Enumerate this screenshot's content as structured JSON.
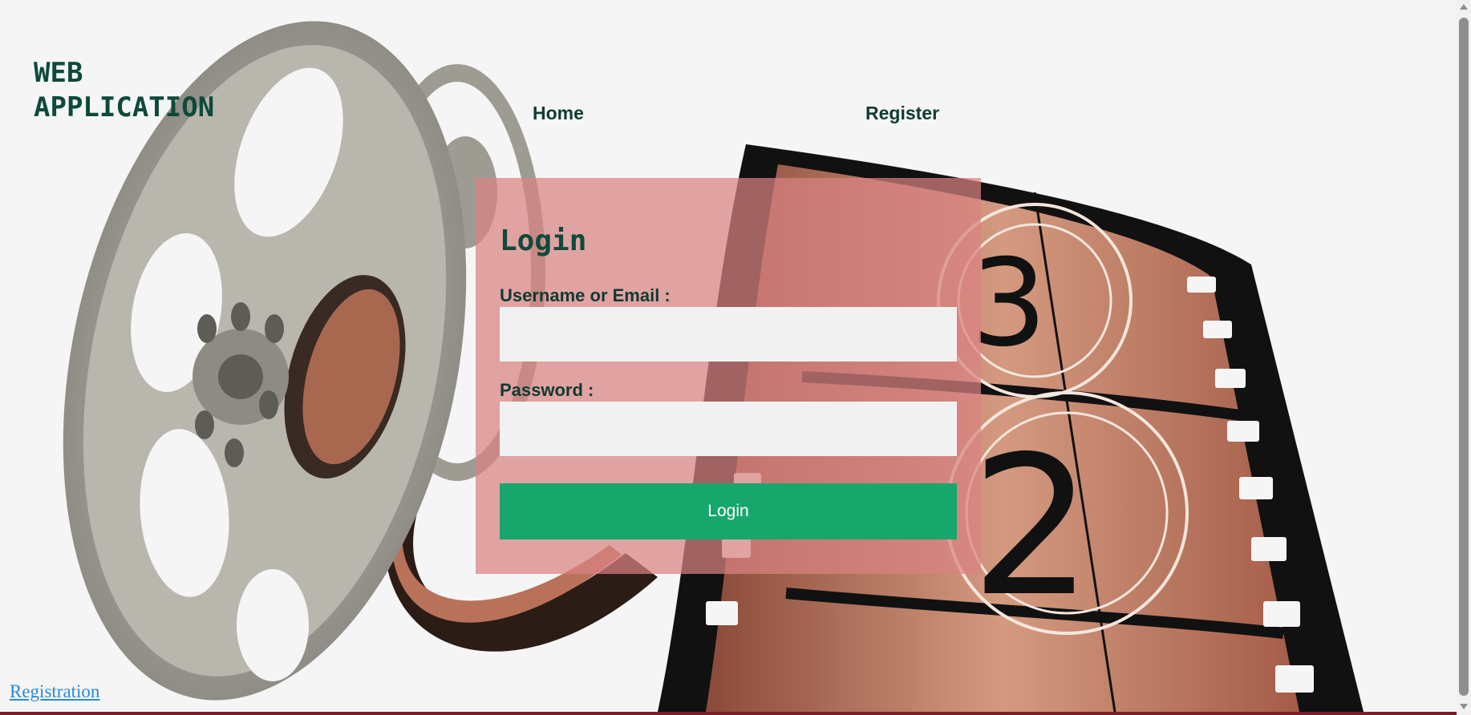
{
  "brand": {
    "line1": "WEB",
    "line2": "APPLICATION"
  },
  "nav": {
    "home": "Home",
    "register": "Register"
  },
  "login_form": {
    "title": "Login",
    "username_label": "Username or Email :",
    "username_value": "",
    "password_label": "Password :",
    "password_value": "",
    "submit_label": "Login"
  },
  "footer": {
    "registration_link": "Registration"
  },
  "colors": {
    "brand_text": "#0e4a3b",
    "panel_bg": "#da8282",
    "button_bg": "#17a76d",
    "link": "#2a8ad6",
    "page_bg": "#f5f5f5"
  },
  "icons": {
    "background": "film-reel-and-film-strip-image",
    "scroll_up": "triangle-up-icon",
    "scroll_down": "triangle-down-icon"
  }
}
